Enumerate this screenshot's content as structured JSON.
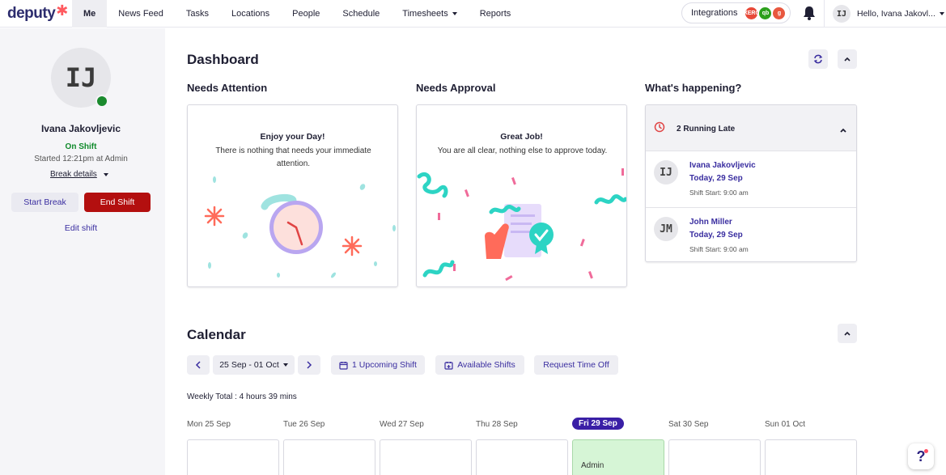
{
  "brand": {
    "name": "deputy",
    "accent": "#ff5a5f"
  },
  "nav": {
    "items": [
      {
        "label": "Me",
        "active": true
      },
      {
        "label": "News Feed"
      },
      {
        "label": "Tasks"
      },
      {
        "label": "Locations"
      },
      {
        "label": "People"
      },
      {
        "label": "Schedule"
      },
      {
        "label": "Timesheets"
      },
      {
        "label": "Reports"
      }
    ],
    "integrations_label": "Integrations",
    "integration_badges": [
      "XERO",
      "qb",
      "g"
    ],
    "greeting": "Hello, Ivana Jakovl...",
    "user_initials": "IJ"
  },
  "sidebar": {
    "initials": "IJ",
    "name": "Ivana Jakovljevic",
    "status": "On Shift",
    "started": "Started 12:21pm at Admin",
    "break_details": "Break details",
    "start_break": "Start Break",
    "end_shift": "End Shift",
    "edit_shift": "Edit shift"
  },
  "dashboard": {
    "title": "Dashboard",
    "needs_attention": {
      "heading": "Needs Attention",
      "title": "Enjoy your Day!",
      "text": "There is nothing that needs your immediate attention."
    },
    "needs_approval": {
      "heading": "Needs Approval",
      "title": "Great Job!",
      "text": "You are all clear, nothing else to approve today."
    },
    "happening": {
      "heading": "What's happening?",
      "late_label": "2 Running Late",
      "rows": [
        {
          "initials": "IJ",
          "name": "Ivana Jakovljevic",
          "date": "Today, 29 Sep",
          "shift": "Shift Start: 9:00 am"
        },
        {
          "initials": "JM",
          "name": "John Miller",
          "date": "Today, 29 Sep",
          "shift": "Shift Start: 9:00 am"
        }
      ]
    }
  },
  "calendar": {
    "title": "Calendar",
    "range": "25 Sep - 01 Oct",
    "upcoming": "1 Upcoming Shift",
    "available": "Available Shifts",
    "request": "Request Time Off",
    "weekly_total": "Weekly Total : 4 hours 39 mins",
    "days": [
      "Mon 25 Sep",
      "Tue 26 Sep",
      "Wed 27 Sep",
      "Thu 28 Sep",
      "Fri 29 Sep",
      "Sat 30 Sep",
      "Sun 01 Oct"
    ],
    "today_cell_label": "Admin"
  },
  "help_label": "?"
}
